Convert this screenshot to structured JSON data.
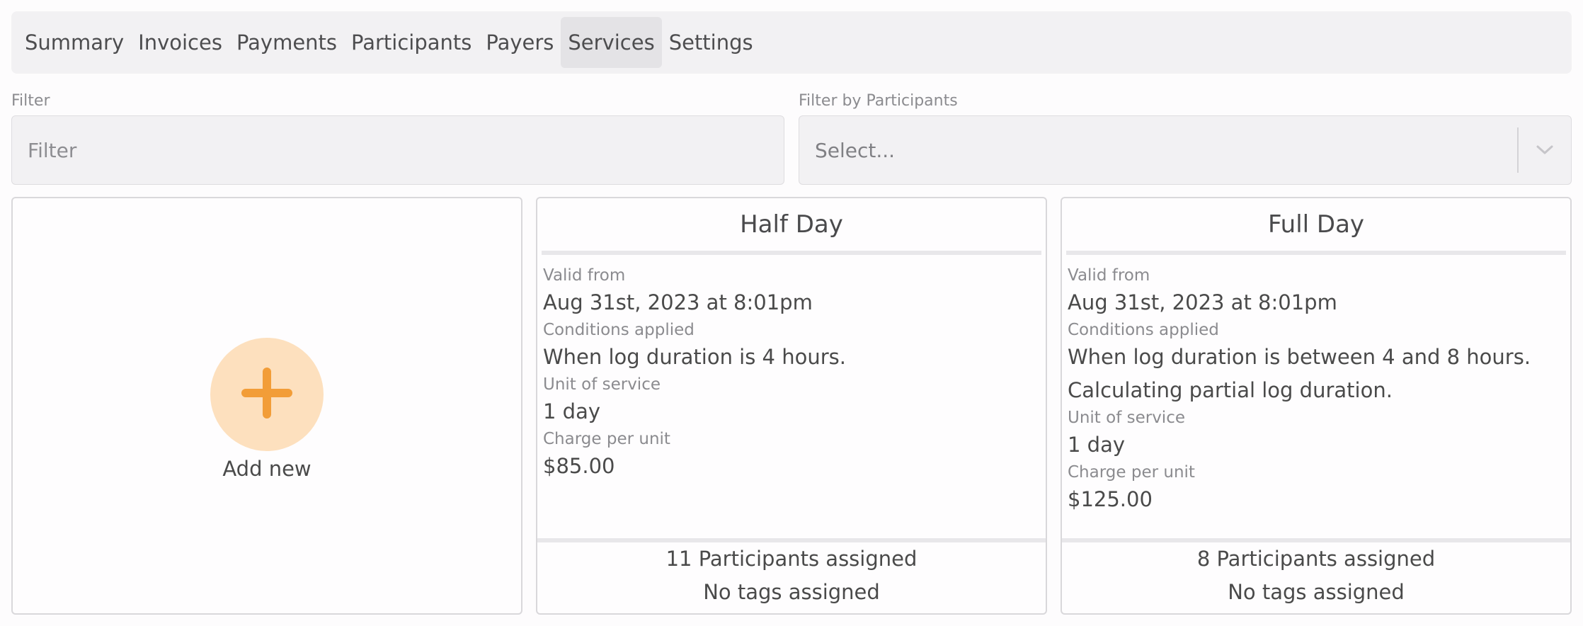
{
  "tabs": [
    {
      "label": "Summary"
    },
    {
      "label": "Invoices"
    },
    {
      "label": "Payments"
    },
    {
      "label": "Participants"
    },
    {
      "label": "Payers"
    },
    {
      "label": "Services",
      "active": true
    },
    {
      "label": "Settings"
    }
  ],
  "filter": {
    "label": "Filter",
    "placeholder": "Filter"
  },
  "participants_filter": {
    "label": "Filter by Participants",
    "value": "Select..."
  },
  "add_new": {
    "label": "Add new"
  },
  "services": [
    {
      "title": "Half Day",
      "valid_from_label": "Valid from",
      "valid_from": "Aug 31st, 2023 at 8:01pm",
      "conditions_label": "Conditions applied",
      "conditions": [
        "When log duration is 4 hours."
      ],
      "unit_label": "Unit of service",
      "unit": "1 day",
      "charge_label": "Charge per unit",
      "charge": "$85.00",
      "participants": "11 Participants assigned",
      "tags": "No tags assigned"
    },
    {
      "title": "Full Day",
      "valid_from_label": "Valid from",
      "valid_from": "Aug 31st, 2023 at 8:01pm",
      "conditions_label": "Conditions applied",
      "conditions": [
        "When log duration is between 4 and 8 hours.",
        "Calculating partial log duration."
      ],
      "unit_label": "Unit of service",
      "unit": "1 day",
      "charge_label": "Charge per unit",
      "charge": "$125.00",
      "participants": "8 Participants assigned",
      "tags": "No tags assigned"
    }
  ],
  "colors": {
    "accent": "#f29d38",
    "accent_light": "#fde0be",
    "tab_bar": "#f2f1f3",
    "tab_active": "#e4e3e6"
  },
  "icons": {
    "add": "plus-icon",
    "select_arrow": "chevron-down-icon"
  }
}
